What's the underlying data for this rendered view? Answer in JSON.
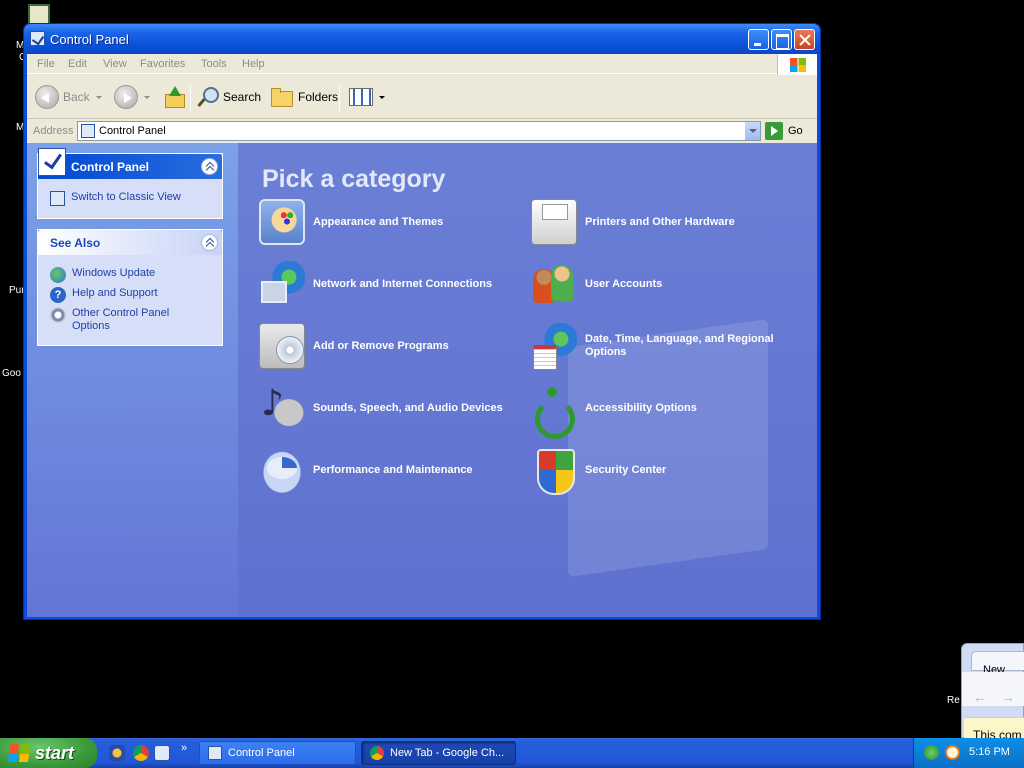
{
  "desktop": {
    "fragments": [
      "M",
      "C",
      "M",
      "Pur",
      "Goo",
      "Re"
    ]
  },
  "window": {
    "title": "Control Panel",
    "menu": [
      "File",
      "Edit",
      "View",
      "Favorites",
      "Tools",
      "Help"
    ],
    "toolbar": {
      "back": "Back",
      "search": "Search",
      "folders": "Folders"
    },
    "address": {
      "label": "Address",
      "value": "Control Panel",
      "go": "Go"
    }
  },
  "left_pane": {
    "panel_title": "Control Panel",
    "switch_view": "Switch to Classic View",
    "see_also_title": "See Also",
    "see_also_links": [
      "Windows Update",
      "Help and Support",
      "Other Control Panel Options"
    ]
  },
  "main": {
    "heading": "Pick a category",
    "categories": [
      "Appearance and Themes",
      "Network and Internet Connections",
      "Add or Remove Programs",
      "Sounds, Speech, and Audio Devices",
      "Performance and Maintenance",
      "Printers and Other Hardware",
      "User Accounts",
      "Date, Time, Language, and Regional Options",
      "Accessibility Options",
      "Security Center"
    ]
  },
  "taskbar": {
    "start_label": "start",
    "quicklaunch_more": "»",
    "tasks": [
      "Control Panel",
      "New Tab - Google Ch..."
    ],
    "clock": "5:16 PM"
  },
  "chrome_window": {
    "tab_label": "New Tab",
    "info_text": "This com"
  }
}
